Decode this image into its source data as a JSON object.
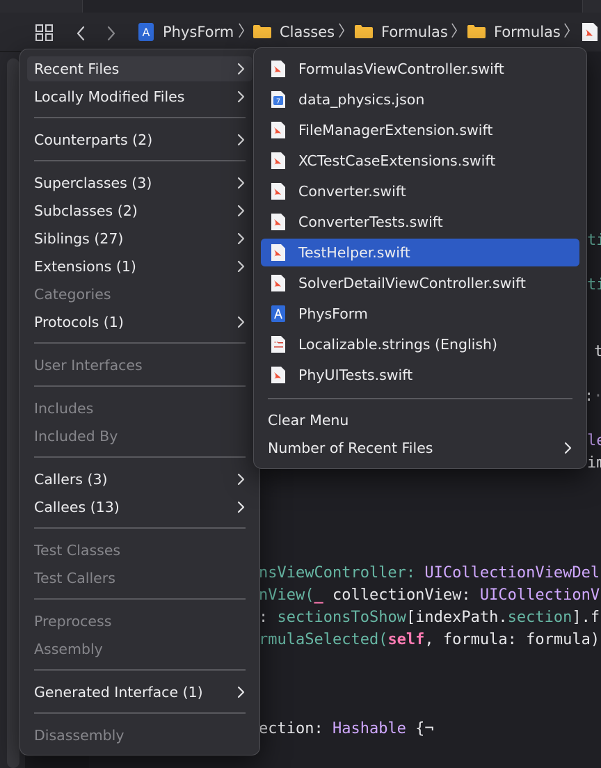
{
  "jumpbar": {
    "crumbs": [
      "PhysForm",
      "Classes",
      "Formulas",
      "Formulas"
    ]
  },
  "code": {
    "line1_a": "nsViewController: ",
    "line1_b": "UICollectionViewDel",
    "line2_a": "nView(",
    "line2_b": "_",
    "line2_c": " collectionView: ",
    "line2_d": "UICollectionV",
    "line3_a": ": ",
    "line3_b": "sectionsToShow",
    "line3_c": "[indexPath.",
    "line3_d": "section",
    "line3_e": "].f",
    "line4_a": "rmulaSelected(",
    "line4_b": "self",
    "line4_c": ", formula: formula)",
    "line5_a": "ection: ",
    "line5_b": "Hashable",
    "line5_c": " {¬",
    "frag_ti1": "ti",
    "frag_ti2": "ti",
    "frag_t": "t",
    "frag_colon": ":",
    "frag_le": "le",
    "frag_im": "im"
  },
  "main_menu": {
    "recent_files": "Recent Files",
    "locally_modified": "Locally Modified Files",
    "counterparts": "Counterparts (2)",
    "superclasses": "Superclasses (3)",
    "subclasses": "Subclasses (2)",
    "siblings": "Siblings (27)",
    "extensions": "Extensions (1)",
    "categories": "Categories",
    "protocols": "Protocols (1)",
    "user_interfaces": "User Interfaces",
    "includes": "Includes",
    "included_by": "Included By",
    "callers": "Callers (3)",
    "callees": "Callees (13)",
    "test_classes": "Test Classes",
    "test_callers": "Test Callers",
    "preprocess": "Preprocess",
    "assembly": "Assembly",
    "generated_interface": "Generated Interface (1)",
    "disassembly": "Disassembly"
  },
  "recent_menu": {
    "files": [
      {
        "name": "FormulasViewController.swift",
        "icon": "swift-file-icon"
      },
      {
        "name": "data_physics.json",
        "icon": "json-file-icon"
      },
      {
        "name": "FileManagerExtension.swift",
        "icon": "swift-file-icon"
      },
      {
        "name": "XCTestCaseExtensions.swift",
        "icon": "swift-file-icon"
      },
      {
        "name": "Converter.swift",
        "icon": "swift-file-icon"
      },
      {
        "name": "ConverterTests.swift",
        "icon": "swift-file-icon"
      },
      {
        "name": "TestHelper.swift",
        "icon": "swift-file-icon"
      },
      {
        "name": "SolverDetailViewController.swift",
        "icon": "swift-file-icon"
      },
      {
        "name": "PhysForm",
        "icon": "xcode-project-icon"
      },
      {
        "name": "Localizable.strings (English)",
        "icon": "strings-file-icon"
      },
      {
        "name": "PhyUITests.swift",
        "icon": "swift-file-icon"
      }
    ],
    "clear_menu": "Clear Menu",
    "number_of_recent": "Number of Recent Files"
  },
  "colors": {
    "selection": "#2d5bc4",
    "menu_bg": "#2f2f34",
    "swift_orange": "#f05138",
    "keyword_pink": "#ff7ab2",
    "type_purple": "#d0a8ff",
    "function_teal": "#67b7a4"
  }
}
